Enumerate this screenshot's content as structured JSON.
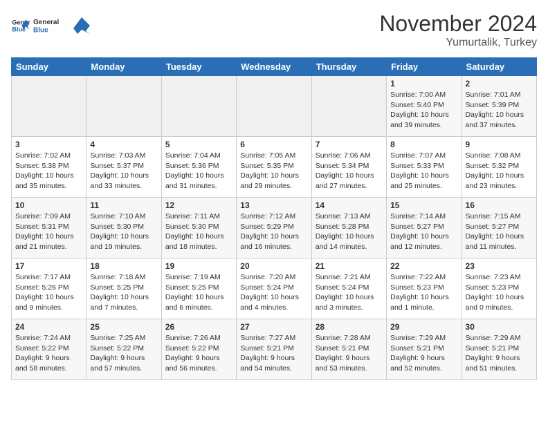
{
  "header": {
    "logo_line1": "General",
    "logo_line2": "Blue",
    "month_title": "November 2024",
    "subtitle": "Yumurtalik, Turkey"
  },
  "days_of_week": [
    "Sunday",
    "Monday",
    "Tuesday",
    "Wednesday",
    "Thursday",
    "Friday",
    "Saturday"
  ],
  "weeks": [
    [
      {
        "day": "",
        "content": ""
      },
      {
        "day": "",
        "content": ""
      },
      {
        "day": "",
        "content": ""
      },
      {
        "day": "",
        "content": ""
      },
      {
        "day": "",
        "content": ""
      },
      {
        "day": "1",
        "content": "Sunrise: 7:00 AM\nSunset: 5:40 PM\nDaylight: 10 hours and 39 minutes."
      },
      {
        "day": "2",
        "content": "Sunrise: 7:01 AM\nSunset: 5:39 PM\nDaylight: 10 hours and 37 minutes."
      }
    ],
    [
      {
        "day": "3",
        "content": "Sunrise: 7:02 AM\nSunset: 5:38 PM\nDaylight: 10 hours and 35 minutes."
      },
      {
        "day": "4",
        "content": "Sunrise: 7:03 AM\nSunset: 5:37 PM\nDaylight: 10 hours and 33 minutes."
      },
      {
        "day": "5",
        "content": "Sunrise: 7:04 AM\nSunset: 5:36 PM\nDaylight: 10 hours and 31 minutes."
      },
      {
        "day": "6",
        "content": "Sunrise: 7:05 AM\nSunset: 5:35 PM\nDaylight: 10 hours and 29 minutes."
      },
      {
        "day": "7",
        "content": "Sunrise: 7:06 AM\nSunset: 5:34 PM\nDaylight: 10 hours and 27 minutes."
      },
      {
        "day": "8",
        "content": "Sunrise: 7:07 AM\nSunset: 5:33 PM\nDaylight: 10 hours and 25 minutes."
      },
      {
        "day": "9",
        "content": "Sunrise: 7:08 AM\nSunset: 5:32 PM\nDaylight: 10 hours and 23 minutes."
      }
    ],
    [
      {
        "day": "10",
        "content": "Sunrise: 7:09 AM\nSunset: 5:31 PM\nDaylight: 10 hours and 21 minutes."
      },
      {
        "day": "11",
        "content": "Sunrise: 7:10 AM\nSunset: 5:30 PM\nDaylight: 10 hours and 19 minutes."
      },
      {
        "day": "12",
        "content": "Sunrise: 7:11 AM\nSunset: 5:30 PM\nDaylight: 10 hours and 18 minutes."
      },
      {
        "day": "13",
        "content": "Sunrise: 7:12 AM\nSunset: 5:29 PM\nDaylight: 10 hours and 16 minutes."
      },
      {
        "day": "14",
        "content": "Sunrise: 7:13 AM\nSunset: 5:28 PM\nDaylight: 10 hours and 14 minutes."
      },
      {
        "day": "15",
        "content": "Sunrise: 7:14 AM\nSunset: 5:27 PM\nDaylight: 10 hours and 12 minutes."
      },
      {
        "day": "16",
        "content": "Sunrise: 7:15 AM\nSunset: 5:27 PM\nDaylight: 10 hours and 11 minutes."
      }
    ],
    [
      {
        "day": "17",
        "content": "Sunrise: 7:17 AM\nSunset: 5:26 PM\nDaylight: 10 hours and 9 minutes."
      },
      {
        "day": "18",
        "content": "Sunrise: 7:18 AM\nSunset: 5:25 PM\nDaylight: 10 hours and 7 minutes."
      },
      {
        "day": "19",
        "content": "Sunrise: 7:19 AM\nSunset: 5:25 PM\nDaylight: 10 hours and 6 minutes."
      },
      {
        "day": "20",
        "content": "Sunrise: 7:20 AM\nSunset: 5:24 PM\nDaylight: 10 hours and 4 minutes."
      },
      {
        "day": "21",
        "content": "Sunrise: 7:21 AM\nSunset: 5:24 PM\nDaylight: 10 hours and 3 minutes."
      },
      {
        "day": "22",
        "content": "Sunrise: 7:22 AM\nSunset: 5:23 PM\nDaylight: 10 hours and 1 minute."
      },
      {
        "day": "23",
        "content": "Sunrise: 7:23 AM\nSunset: 5:23 PM\nDaylight: 10 hours and 0 minutes."
      }
    ],
    [
      {
        "day": "24",
        "content": "Sunrise: 7:24 AM\nSunset: 5:22 PM\nDaylight: 9 hours and 58 minutes."
      },
      {
        "day": "25",
        "content": "Sunrise: 7:25 AM\nSunset: 5:22 PM\nDaylight: 9 hours and 57 minutes."
      },
      {
        "day": "26",
        "content": "Sunrise: 7:26 AM\nSunset: 5:22 PM\nDaylight: 9 hours and 56 minutes."
      },
      {
        "day": "27",
        "content": "Sunrise: 7:27 AM\nSunset: 5:21 PM\nDaylight: 9 hours and 54 minutes."
      },
      {
        "day": "28",
        "content": "Sunrise: 7:28 AM\nSunset: 5:21 PM\nDaylight: 9 hours and 53 minutes."
      },
      {
        "day": "29",
        "content": "Sunrise: 7:29 AM\nSunset: 5:21 PM\nDaylight: 9 hours and 52 minutes."
      },
      {
        "day": "30",
        "content": "Sunrise: 7:29 AM\nSunset: 5:21 PM\nDaylight: 9 hours and 51 minutes."
      }
    ]
  ]
}
